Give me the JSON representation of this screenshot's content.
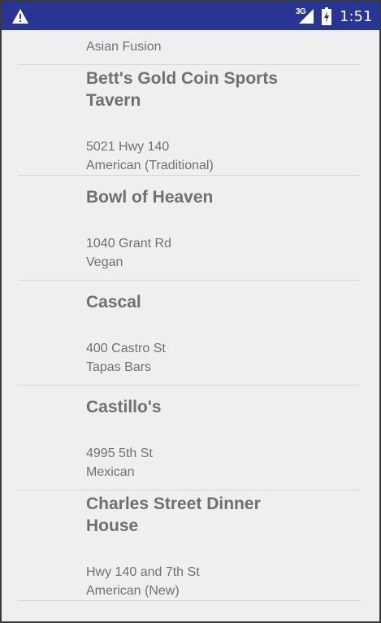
{
  "status_bar": {
    "network_type": "3G",
    "time": "1:51",
    "icons": [
      "warning-icon",
      "signal-icon",
      "battery-charging-icon"
    ],
    "background_color": "#283593"
  },
  "partial_top_item": {
    "category": "Asian Fusion"
  },
  "restaurants": [
    {
      "name": "Bett's Gold Coin Sports Tavern",
      "address": "5021 Hwy 140",
      "category": "American (Traditional)"
    },
    {
      "name": "Bowl of Heaven",
      "address": "1040 Grant Rd",
      "category": "Vegan"
    },
    {
      "name": "Cascal",
      "address": "400 Castro St",
      "category": "Tapas Bars"
    },
    {
      "name": "Castillo's",
      "address": "4995 5th St",
      "category": "Mexican"
    },
    {
      "name": "Charles Street Dinner House",
      "address": "Hwy 140 and 7th St",
      "category": "American (New)"
    }
  ]
}
